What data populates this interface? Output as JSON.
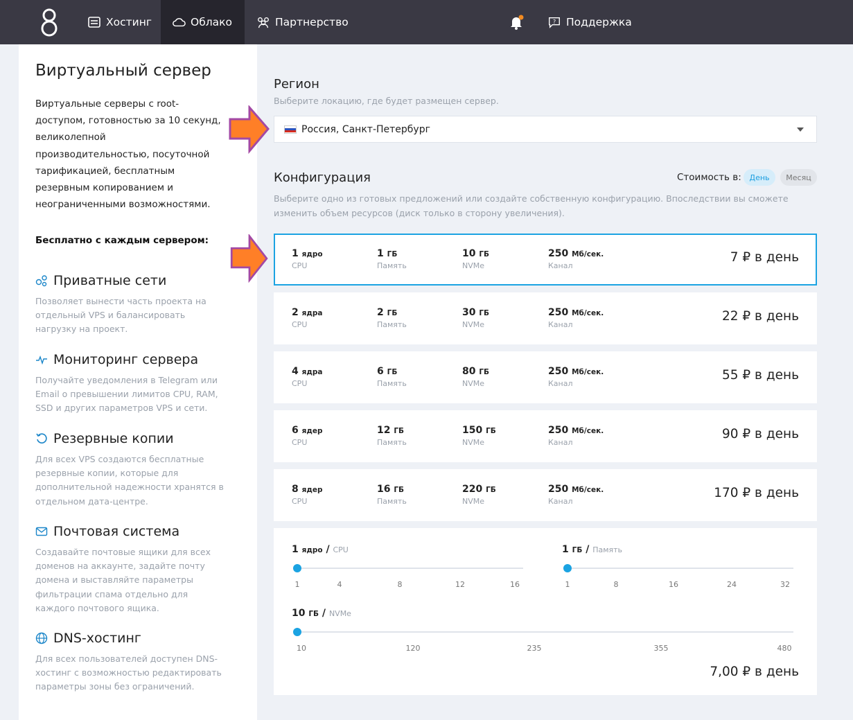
{
  "nav": {
    "items": [
      {
        "label": "Хостинг",
        "icon": "hosting-icon"
      },
      {
        "label": "Облако",
        "icon": "cloud-icon",
        "active": true
      },
      {
        "label": "Партнерство",
        "icon": "partners-icon"
      }
    ],
    "support_label": "Поддержка"
  },
  "left": {
    "title": "Виртуальный сервер",
    "intro": "Виртуальные серверы с root-доступом, готовностью за 10 секунд, великолепной производительностью, посуточной тарификацией, бесплатным резервным копированием и неограниченными возможностями.",
    "free_title": "Бесплатно с каждым сервером:",
    "features": [
      {
        "icon": "network-icon",
        "title": "Приватные сети",
        "desc": "Позволяет вынести часть проекта на отдельный VPS и балансировать нагрузку на проект."
      },
      {
        "icon": "pulse-icon",
        "title": "Мониторинг сервера",
        "desc": "Получайте уведомления в Telegram или Email о превышении лимитов CPU, RAM, SSD и других параметров VPS и сети."
      },
      {
        "icon": "refresh-icon",
        "title": "Резервные копии",
        "desc": "Для всех VPS создаются бесплатные резервные копии, которые для дополнительной надежности хранятся в отдельном дата-центре."
      },
      {
        "icon": "mail-icon",
        "title": "Почтовая система",
        "desc": "Создавайте почтовые ящики для всех доменов на аккаунте, задайте почту домена и выставляйте параметры фильтрации спама отдельно для каждого почтового ящика."
      },
      {
        "icon": "globe-icon",
        "title": "DNS-хостинг",
        "desc": "Для всех пользователей доступен DNS-хостинг с возможностью редактировать параметры зоны без ограничений."
      }
    ]
  },
  "region": {
    "title": "Регион",
    "subtitle": "Выберите локацию, где будет размещен сервер.",
    "selected": "Россия, Санкт-Петербург"
  },
  "config": {
    "title": "Конфигурация",
    "subtitle": "Выберите одно из готовых предложений или создайте собственную конфигурацию. Впоследствии вы сможете изменить объем ресурсов (диск только в сторону увеличения).",
    "cost_label": "Стоимость в:",
    "period_day": "День",
    "period_month": "Месяц",
    "col_labels": {
      "cpu": "CPU",
      "ram": "Память",
      "disk": "NVMe",
      "net": "Канал"
    },
    "plans": [
      {
        "cpu": "1",
        "cpu_unit": "ядро",
        "ram": "1",
        "ram_unit": "ГБ",
        "disk": "10",
        "disk_unit": "ГБ",
        "net": "250",
        "net_unit": "Мб/сек.",
        "price": "7 ₽ в день"
      },
      {
        "cpu": "2",
        "cpu_unit": "ядра",
        "ram": "2",
        "ram_unit": "ГБ",
        "disk": "30",
        "disk_unit": "ГБ",
        "net": "250",
        "net_unit": "Мб/сек.",
        "price": "22 ₽ в день"
      },
      {
        "cpu": "4",
        "cpu_unit": "ядра",
        "ram": "6",
        "ram_unit": "ГБ",
        "disk": "80",
        "disk_unit": "ГБ",
        "net": "250",
        "net_unit": "Мб/сек.",
        "price": "55 ₽ в день"
      },
      {
        "cpu": "6",
        "cpu_unit": "ядер",
        "ram": "12",
        "ram_unit": "ГБ",
        "disk": "150",
        "disk_unit": "ГБ",
        "net": "250",
        "net_unit": "Мб/сек.",
        "price": "90 ₽ в день"
      },
      {
        "cpu": "8",
        "cpu_unit": "ядер",
        "ram": "16",
        "ram_unit": "ГБ",
        "disk": "220",
        "disk_unit": "ГБ",
        "net": "250",
        "net_unit": "Мб/сек.",
        "price": "170 ₽ в день"
      }
    ]
  },
  "custom": {
    "cpu": {
      "value": "1",
      "unit": "ядро",
      "label": "CPU",
      "ticks": [
        "1",
        "4",
        "8",
        "12",
        "16"
      ]
    },
    "ram": {
      "value": "1",
      "unit": "ГБ",
      "label": "Память",
      "ticks": [
        "1",
        "8",
        "16",
        "24",
        "32"
      ]
    },
    "disk": {
      "value": "10",
      "unit": "ГБ",
      "label": "NVMe",
      "ticks": [
        "10",
        "120",
        "235",
        "355",
        "480"
      ]
    },
    "price": "7,00 ₽ в день"
  },
  "colors": {
    "accent": "#1ba3e2",
    "nav_bg": "#3a3944",
    "arrow": "#ff7f27",
    "arrow_outline": "#a349a4"
  }
}
